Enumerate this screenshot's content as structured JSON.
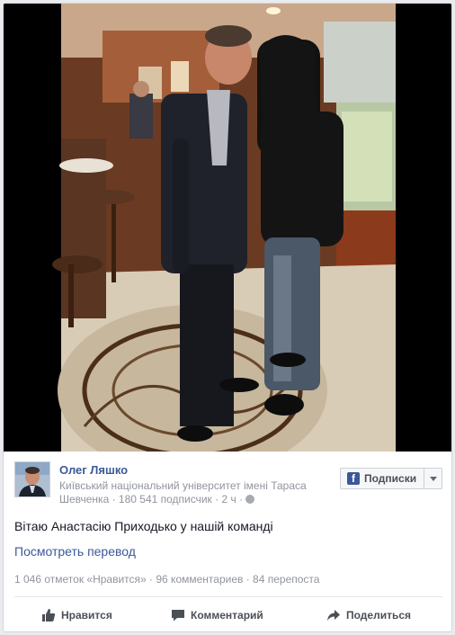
{
  "post": {
    "page_name": "Олег Ляшко",
    "meta_line_1": "Київський національний університет імені Тараса",
    "meta_line_2": "Шевченка · 180 541 подписчик · 2 ч ·",
    "follow_label": "Подписки",
    "text": "Вітаю Анастасію Приходько у нашій команді",
    "see_translation": "Посмотреть перевод",
    "stats": "1 046 отметок «Нравится» · 96 комментариев · 84 перепоста"
  },
  "actions": {
    "like": "Нравится",
    "comment": "Комментарий",
    "share": "Поделиться"
  },
  "icons": {
    "brand": "facebook-f-icon",
    "privacy": "globe-icon",
    "like": "thumbs-up-icon",
    "comment": "speech-bubble-icon",
    "share": "share-arrow-icon",
    "follow_menu": "chevron-down-icon"
  },
  "colors": {
    "link": "#3b5998",
    "muted": "#90949c",
    "action": "#4b4f56"
  }
}
